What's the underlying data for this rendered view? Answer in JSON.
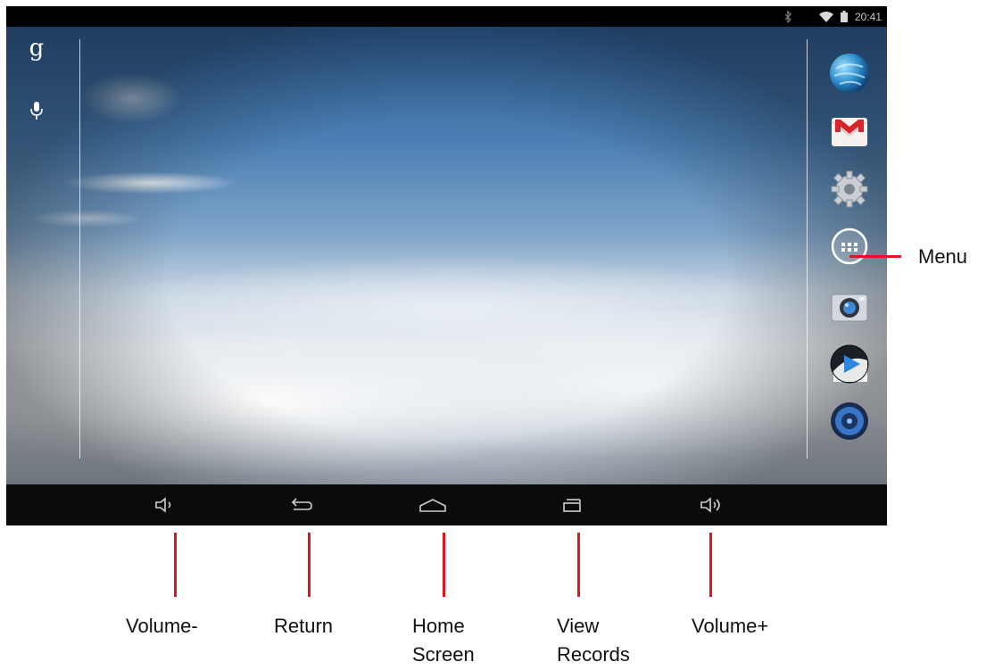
{
  "status": {
    "time": "20:41",
    "icons": [
      "bluetooth-icon",
      "wifi-icon",
      "battery-icon"
    ]
  },
  "left_shortcuts": [
    {
      "name": "google-search-icon",
      "glyph": "g"
    },
    {
      "name": "microphone-icon"
    }
  ],
  "dock_apps": [
    {
      "name": "browser-globe-icon"
    },
    {
      "name": "gmail-icon"
    },
    {
      "name": "settings-gear-icon"
    },
    {
      "name": "app-menu-icon"
    },
    {
      "name": "camera-icon"
    },
    {
      "name": "video-player-icon"
    },
    {
      "name": "music-player-icon"
    }
  ],
  "nav_buttons": [
    {
      "name": "volume-down-icon"
    },
    {
      "name": "back-icon"
    },
    {
      "name": "home-icon"
    },
    {
      "name": "recent-apps-icon"
    },
    {
      "name": "volume-up-icon"
    }
  ],
  "labels": {
    "menu": "Menu",
    "volume_down": "Volume-",
    "return": "Return",
    "home": "Home\nScreen",
    "view_records": "View\nRecords",
    "volume_up": "Volume+"
  },
  "colors": {
    "callout": "#e1161c",
    "navbar": "#0b0b0b"
  }
}
